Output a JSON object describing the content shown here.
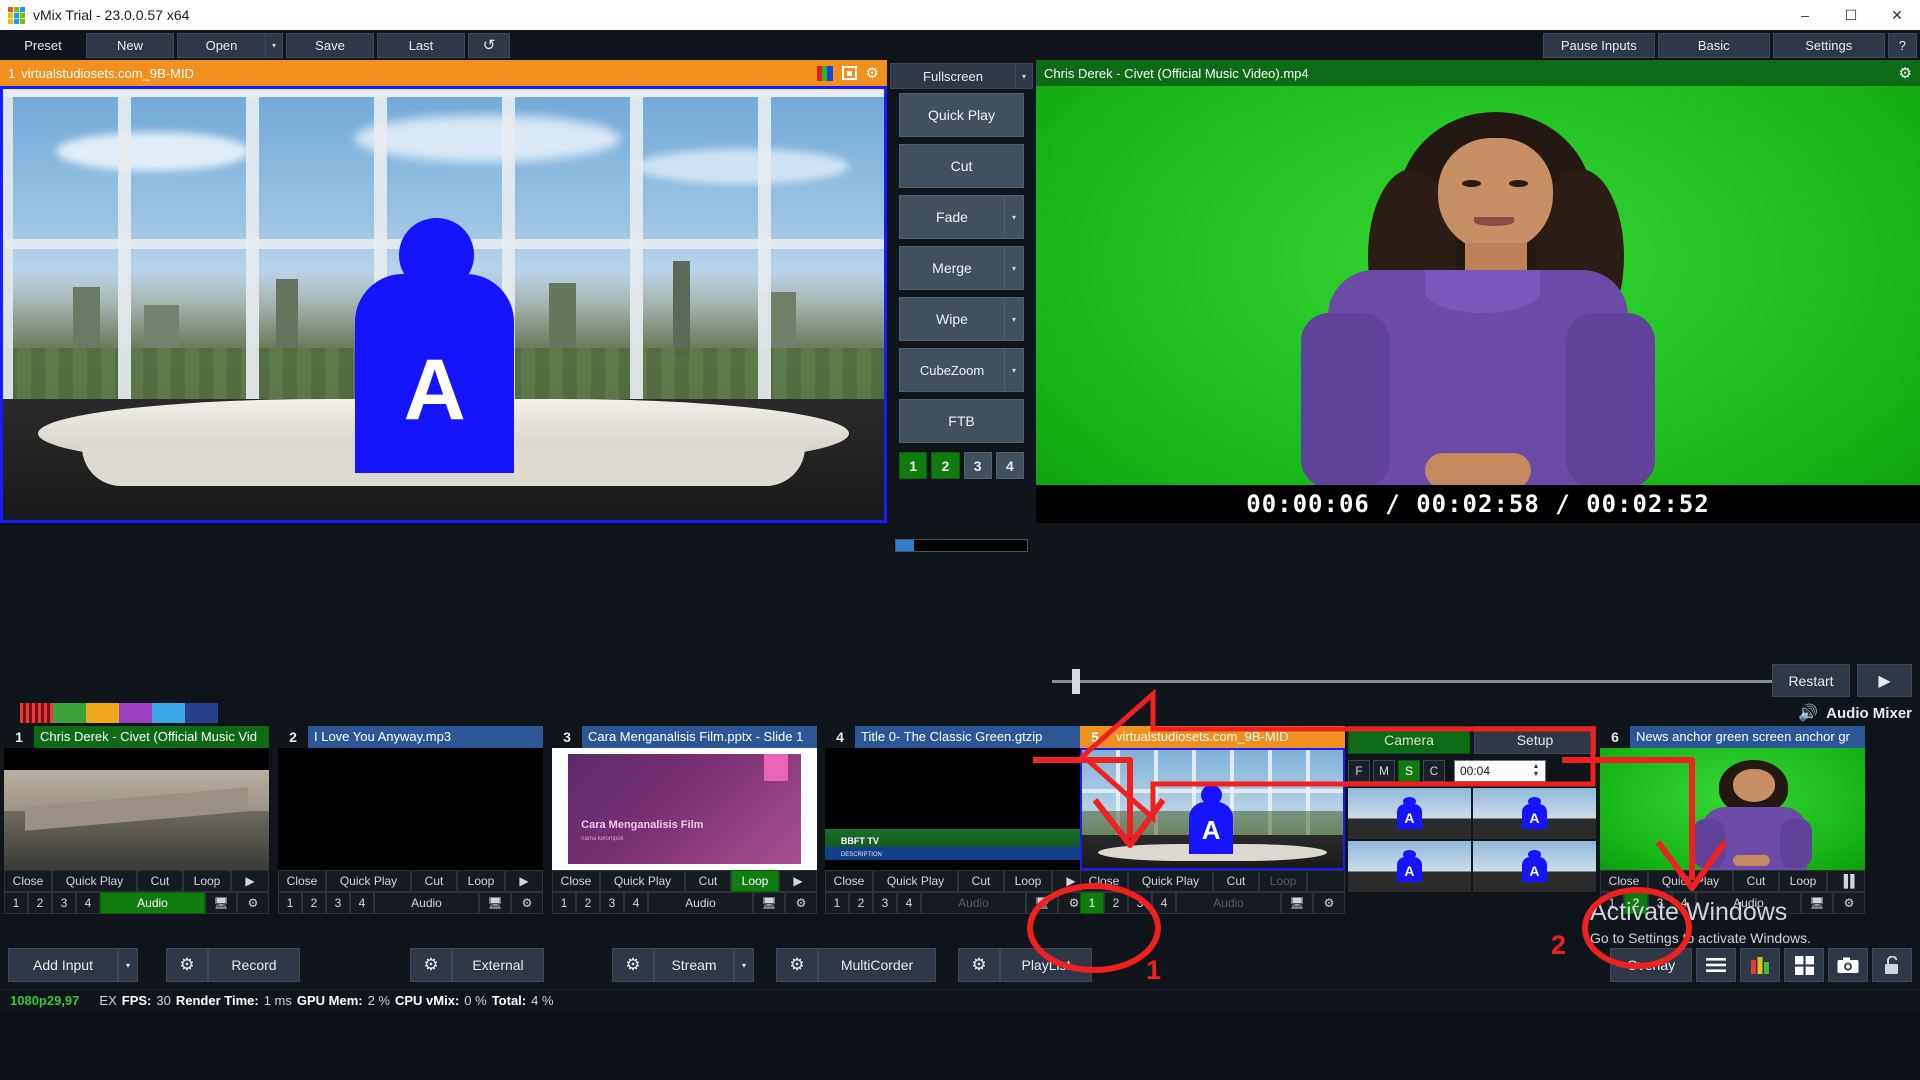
{
  "window": {
    "title": "vMix Trial - 23.0.0.57 x64",
    "minimize": "–",
    "maximize": "☐",
    "close": "✕",
    "logo_colors": [
      "#f25022",
      "#7fba00",
      "#00a4ef",
      "#ffb900",
      "#00a4ef",
      "#7fba00",
      "#ffb900",
      "#00a4ef",
      "#7fba00"
    ]
  },
  "toolbar": {
    "preset": "Preset",
    "new": "New",
    "open": "Open",
    "open_arrow": "▾",
    "save": "Save",
    "last": "Last",
    "refresh_icon": "↺",
    "pause_inputs": "Pause Inputs",
    "basic": "Basic",
    "settings": "Settings",
    "help": "?"
  },
  "preview": {
    "number": "1",
    "title": "virtualstudiosets.com_9B-MID",
    "icons": [
      "rgb-icon",
      "snapshot-icon",
      "gear-icon"
    ],
    "header_color": "#f0901e"
  },
  "program": {
    "title": "Chris Derek - Civet (Official Music Video).mp4",
    "header_color": "#0d6b16",
    "gear_icon": "gear-icon",
    "timecode": "00:00:06  /  00:02:58  /  00:02:52",
    "restart": "Restart",
    "play": "▶"
  },
  "transitions": {
    "fullscreen": "Fullscreen",
    "fullscreen_arrow": "▾",
    "buttons": [
      {
        "label": "Quick Play",
        "arrow": false
      },
      {
        "label": "Cut",
        "arrow": false
      },
      {
        "label": "Fade",
        "arrow": true
      },
      {
        "label": "Merge",
        "arrow": true
      },
      {
        "label": "Wipe",
        "arrow": true
      },
      {
        "label": "CubeZoom",
        "arrow": true
      },
      {
        "label": "FTB",
        "arrow": false
      }
    ],
    "numbers": [
      {
        "label": "1",
        "active": true
      },
      {
        "label": "2",
        "active": true
      },
      {
        "label": "3",
        "active": false
      },
      {
        "label": "4",
        "active": false
      }
    ]
  },
  "swatches": [
    "#9b1c1c",
    "#3aa33a",
    "#f0a81e",
    "#9b3fbf",
    "#3aa7e8",
    "#2b3f8f"
  ],
  "audio_mixer": {
    "label": "Audio Mixer",
    "icon": "speaker-icon"
  },
  "inputs": [
    {
      "number": "1",
      "name": "Chris Derek - Civet (Official Music Vid",
      "name_style": "green",
      "controls": [
        "Close",
        "Quick Play",
        "Cut",
        "Loop"
      ],
      "play_icon": "▶",
      "loop_dim": false,
      "nums": [
        "1",
        "2",
        "3",
        "4"
      ],
      "active_num": null,
      "audio": "Audio",
      "audio_on": true,
      "monitor_icon": "monitor-icon",
      "gear_icon": "gear-icon"
    },
    {
      "number": "2",
      "name": "I Love You Anyway.mp3",
      "name_style": "blue",
      "controls": [
        "Close",
        "Quick Play",
        "Cut",
        "Loop"
      ],
      "play_icon": "▶",
      "loop_dim": false,
      "nums": [
        "1",
        "2",
        "3",
        "4"
      ],
      "active_num": null,
      "audio": "Audio",
      "audio_on": false,
      "monitor_icon": "monitor-icon",
      "gear_icon": "gear-icon"
    },
    {
      "number": "3",
      "name": "Cara Menganalisis Film.pptx - Slide 1",
      "name_style": "blue",
      "controls": [
        "Close",
        "Quick Play",
        "Cut",
        "Loop"
      ],
      "play_icon": "▶",
      "loop_on": true,
      "nums": [
        "1",
        "2",
        "3",
        "4"
      ],
      "active_num": null,
      "audio": "Audio",
      "audio_on": false,
      "monitor_icon": "monitor-icon",
      "gear_icon": "gear-icon",
      "slide_title": "Cara Menganalisis Film",
      "slide_sub": "nama kelompok"
    },
    {
      "number": "4",
      "name": "Title 0- The Classic Green.gtzip",
      "name_style": "blue",
      "controls": [
        "Close",
        "Quick Play",
        "Cut",
        "Loop"
      ],
      "play_icon": "▶",
      "loop_dim": false,
      "nums": [
        "1",
        "2",
        "3",
        "4"
      ],
      "active_num": null,
      "audio": "Audio",
      "audio_dim": true,
      "monitor_icon": "monitor-icon",
      "gear_icon": "gear-icon",
      "title_line1": "BBFT TV",
      "title_line2": "DESCRIPTION"
    },
    {
      "number": "5",
      "name": "virtualstudiosets.com_9B-MID",
      "name_style": "orange",
      "controls": [
        "Close",
        "Quick Play",
        "Cut",
        "Loop"
      ],
      "loop_dim": true,
      "nums": [
        "1",
        "2",
        "3",
        "4"
      ],
      "active_num": "1",
      "audio": "Audio",
      "audio_dim": true,
      "monitor_icon": "monitor-icon",
      "gear_icon": "gear-icon"
    },
    {
      "number": "6",
      "name": "News anchor green screen anchor gr",
      "name_style": "blue",
      "controls": [
        "Close",
        "Quick Play",
        "Cut",
        "Loop"
      ],
      "play_icon": "▐▐",
      "loop_dim": false,
      "nums": [
        "1",
        "2",
        "3",
        "4"
      ],
      "active_num": "2",
      "audio": "Audio",
      "audio_on": false,
      "monitor_icon": "monitor-icon",
      "gear_icon": "gear-icon"
    }
  ],
  "camera_panel": {
    "tabs": [
      {
        "label": "Camera",
        "active": true
      },
      {
        "label": "Setup",
        "active": false
      }
    ],
    "fmsc": [
      {
        "label": "F",
        "active": false
      },
      {
        "label": "M",
        "active": false
      },
      {
        "label": "S",
        "active": true
      },
      {
        "label": "C",
        "active": false
      }
    ],
    "duration": "00:04",
    "spinner_up": "▲",
    "spinner_down": "▼"
  },
  "bottom_bar": {
    "add_input": "Add Input",
    "add_input_arrow": "▾",
    "record": "Record",
    "external": "External",
    "stream": "Stream",
    "stream_arrow": "▾",
    "multicorder": "MultiCorder",
    "playlist": "PlayList",
    "overlay": "Overlay",
    "gear_icon": "gear-icon",
    "icons": [
      "list-icon",
      "audio-bars-icon",
      "grid-icon",
      "camera-icon",
      "lock-icon"
    ]
  },
  "status_bar": {
    "resolution": "1080p29,97",
    "ex": "EX",
    "fps_label": "FPS:",
    "fps_value": "30",
    "render_label": "Render Time:",
    "render_value": "1 ms",
    "gpu_label": "GPU Mem:",
    "gpu_value": "2 %",
    "cpu_label": "CPU vMix:",
    "cpu_value": "0 %",
    "total_label": "Total:",
    "total_value": "4 %"
  },
  "annotations": {
    "color": "#ee2020",
    "marker_1": "1",
    "marker_2": "2"
  },
  "watermark": {
    "line1": "Activate Windows",
    "line2": "Go to Settings to activate Windows."
  }
}
